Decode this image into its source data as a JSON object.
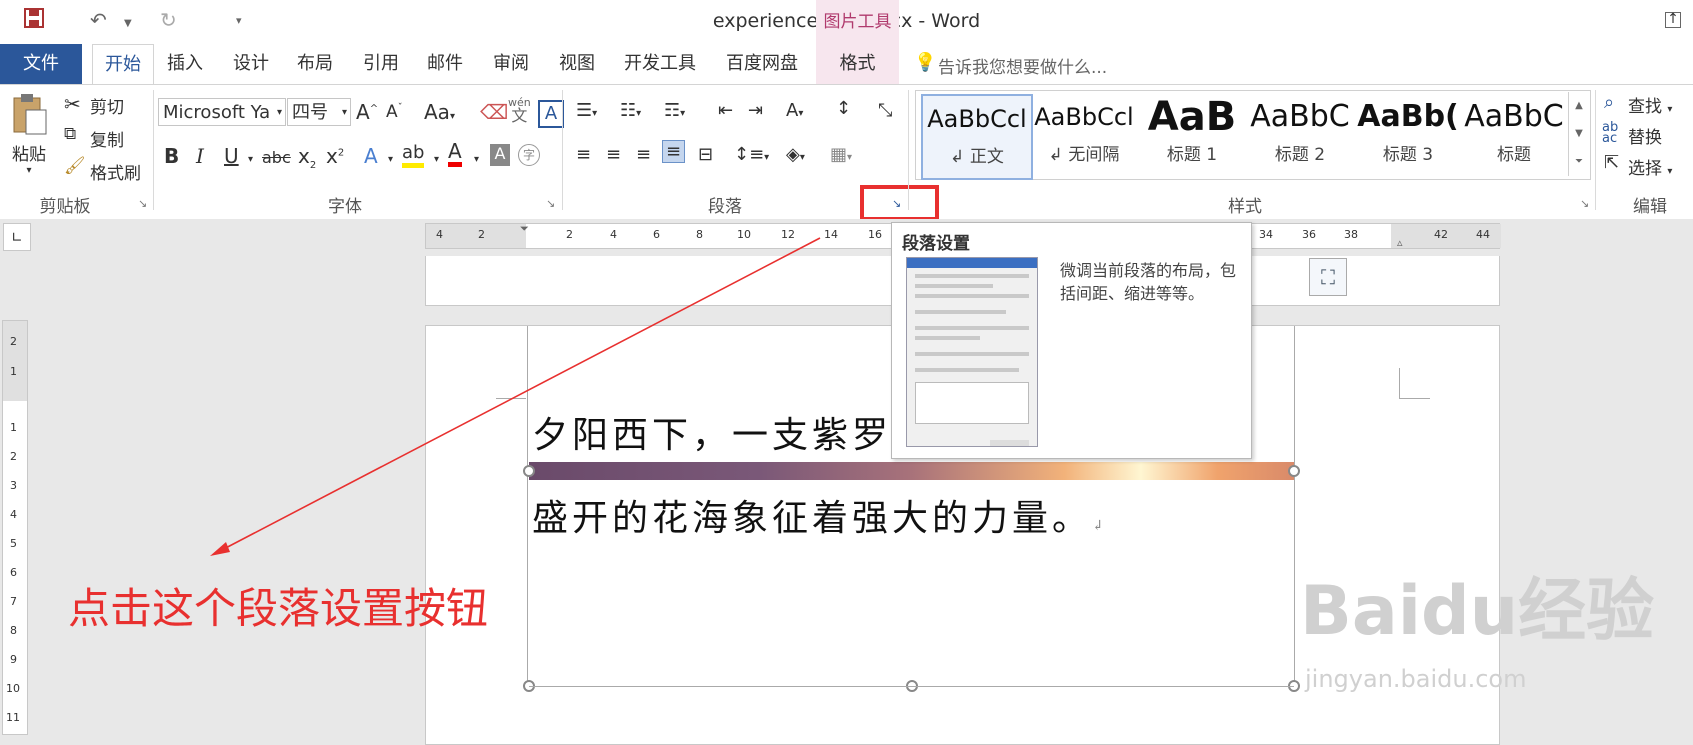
{
  "window": {
    "title": "experiencedata.docx - Word",
    "context_tab_title": "图片工具"
  },
  "tabs": [
    "文件",
    "开始",
    "插入",
    "设计",
    "布局",
    "引用",
    "邮件",
    "审阅",
    "视图",
    "开发工具",
    "百度网盘",
    "格式"
  ],
  "tell_me": {
    "placeholder": "告诉我您想要做什么..."
  },
  "clipboard": {
    "paste": "粘贴",
    "cut": "剪切",
    "copy": "复制",
    "format_painter": "格式刷",
    "group_label": "剪贴板"
  },
  "font": {
    "name": "Microsoft Ya",
    "size": "四号",
    "group_label": "字体",
    "pinyin_top": "wén",
    "pinyin_bottom": "文",
    "case": "Aa"
  },
  "paragraph": {
    "group_label": "段落"
  },
  "styles": {
    "items": [
      {
        "sample": "AaBbCcl",
        "name": "正文"
      },
      {
        "sample": "AaBbCcl",
        "name": "无间隔"
      },
      {
        "sample": "AaB",
        "name": "标题 1"
      },
      {
        "sample": "AaBbC",
        "name": "标题 2"
      },
      {
        "sample": "AaBb(",
        "name": "标题 3"
      },
      {
        "sample": "AaBbC",
        "name": "标题"
      }
    ],
    "group_label": "样式"
  },
  "editing": {
    "find": "查找",
    "replace": "替换",
    "select": "选择",
    "group_label": "编辑"
  },
  "ruler_h": [
    "4",
    "2",
    "2",
    "4",
    "6",
    "8",
    "10",
    "12",
    "14",
    "16",
    "34",
    "36",
    "38",
    "42",
    "44"
  ],
  "ruler_v": [
    "2",
    "1",
    "1",
    "2",
    "3",
    "4",
    "5",
    "6",
    "7",
    "8",
    "9",
    "10",
    "11"
  ],
  "document": {
    "line1": "夕阳西下，一支紫罗",
    "line2": "盛开的花海象征着强大的力量。"
  },
  "tooltip": {
    "title": "段落设置",
    "description": "微调当前段落的布局，包括间距、缩进等等。"
  },
  "annotation": "点击这个段落设置按钮",
  "watermark": {
    "text": "Baidu经验",
    "url": "jingyan.baidu.com"
  },
  "colors": {
    "file_tab": "#2b579a",
    "context_tab": "#b03a6d",
    "annotation_red": "#e8302f"
  }
}
